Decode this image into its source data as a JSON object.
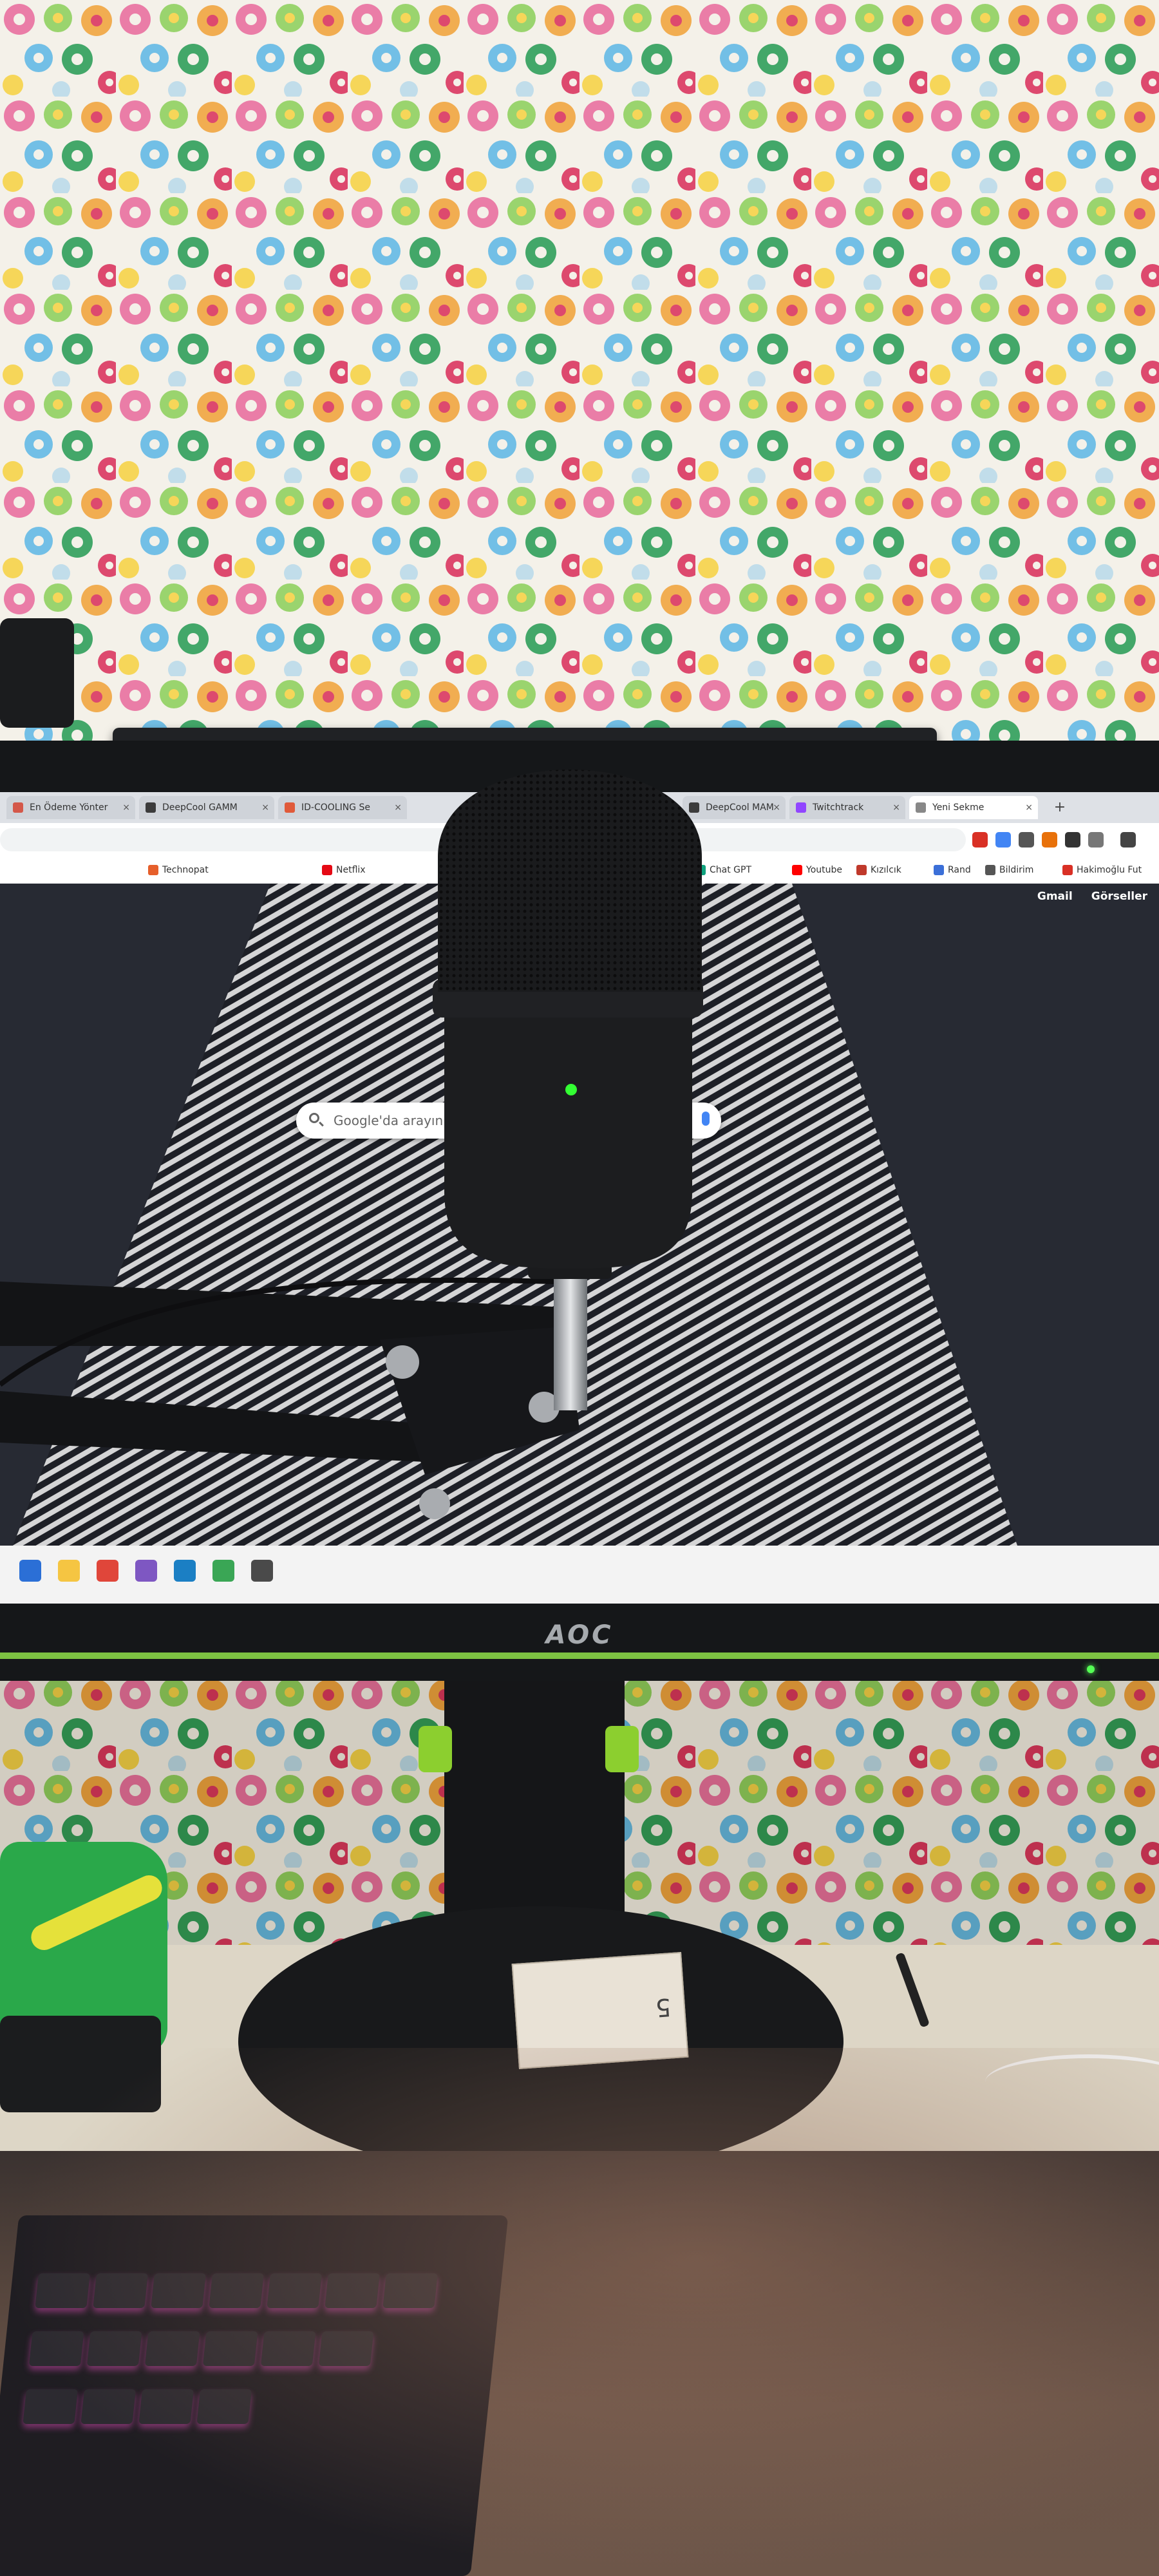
{
  "scene": {
    "description_tags": [
      "curtain",
      "monitor",
      "microphone",
      "boom-arm",
      "desk",
      "keyboard"
    ]
  },
  "browser": {
    "tabs": [
      {
        "label": "En Ödeme Yönter",
        "favicon_color": "#d4584a"
      },
      {
        "label": "DeepCool GAMM",
        "favicon_color": "#3c3c3c"
      },
      {
        "label": "ID-COOLING Se",
        "favicon_color": "#e05a3a"
      },
      {
        "label": "DeepCool MAM",
        "favicon_color": "#3c3c3c"
      },
      {
        "label": "Twitchtrack",
        "favicon_color": "#9146ff"
      },
      {
        "label": "Yeni Sekme",
        "favicon_color": "#888888",
        "active": true
      }
    ],
    "newtab_button": "+",
    "bookmarks": [
      {
        "label": "Technopat",
        "color": "#e65f2b"
      },
      {
        "label": "Netflix",
        "color": "#e50914"
      },
      {
        "label": "Chat GPT",
        "color": "#10a37f"
      },
      {
        "label": "Youtube",
        "color": "#ff0000"
      },
      {
        "label": "Kızılcık",
        "color": "#c0392b"
      },
      {
        "label": "Rand",
        "color": "#3b6fd8"
      },
      {
        "label": "Bildirim",
        "color": "#555555"
      },
      {
        "label": "Hakimoğlu Fut",
        "color": "#d93025"
      }
    ],
    "top_links": [
      "Gmail",
      "Görseller"
    ],
    "search": {
      "placeholder": "Google'da arayın ve"
    }
  },
  "monitor": {
    "brand": "AOC",
    "accent_color": "#7dc242",
    "power_led_color": "#55ff55"
  },
  "base_label": {
    "text": "5"
  },
  "colors": {
    "screen_bg": "#272a33",
    "bezel": "#151719",
    "mic_body": "#1c1d1f",
    "mic_led": "#33ff33",
    "keyboard_glow": "#f050c8"
  }
}
